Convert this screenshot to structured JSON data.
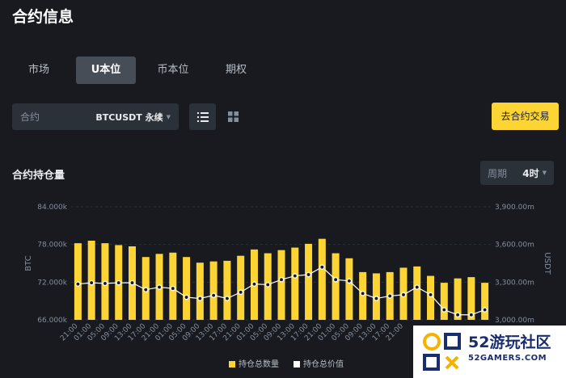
{
  "page": {
    "title": "合约信息"
  },
  "tabs": [
    {
      "label": "市场",
      "active": false
    },
    {
      "label": "U本位",
      "active": true
    },
    {
      "label": "币本位",
      "active": false
    },
    {
      "label": "期权",
      "active": false
    }
  ],
  "contract": {
    "label": "合约",
    "value": "BTCUSDT 永续"
  },
  "toolbar": {
    "list_view_icon": "list-icon",
    "grid_view_icon": "grid-icon",
    "trade_label": "去合约交易"
  },
  "section": {
    "title": "合约持仓量"
  },
  "period": {
    "label": "周期",
    "value": "4时"
  },
  "colors": {
    "accent": "#fcd535",
    "background": "#181a20",
    "panel": "#2b3139",
    "line": "#ffffff"
  },
  "chart_data": {
    "type": "bar",
    "x": [
      "21:00",
      "01:00",
      "05:00",
      "09:00",
      "13:00",
      "17:00",
      "21:00",
      "01:00",
      "05:00",
      "09:00",
      "13:00",
      "17:00",
      "21:00",
      "01:00",
      "05:00",
      "09:00",
      "13:00",
      "17:00",
      "21:00",
      "01:00",
      "05:00",
      "09:00",
      "13:00",
      "17:00",
      "21:00",
      "01:00",
      "05:00",
      "09:00",
      "13:00",
      "17:00",
      "21:00"
    ],
    "x_tick_labels": [
      "21:00",
      "01:00",
      "05:00",
      "09:00",
      "13:00",
      "17:00",
      "21:00",
      "01:00",
      "05:00",
      "09:00",
      "13:00",
      "17:00",
      "21:00",
      "01:00",
      "05:00",
      "09:00",
      "13:00",
      "17:00",
      "21:00",
      "01:00",
      "05:00",
      "09:00",
      "13:00",
      "17:00",
      "21:00"
    ],
    "y_left": {
      "label": "BTC",
      "ticks": [
        "84.000k",
        "78.000k",
        "72.000k",
        "66.000k"
      ],
      "range": [
        66000,
        84000
      ]
    },
    "y_right": {
      "label": "USDT",
      "ticks": [
        "3,900.00m",
        "3,600.00m",
        "3,300.00m",
        "3,000.00m"
      ],
      "range": [
        3000,
        3900
      ]
    },
    "series": [
      {
        "name": "持仓总数量",
        "type": "bar",
        "axis": "left",
        "color": "#fcd535",
        "values": [
          78200,
          78600,
          78200,
          77900,
          77700,
          76000,
          76500,
          76700,
          76000,
          75100,
          75300,
          75400,
          76200,
          77200,
          76600,
          77100,
          77500,
          78100,
          78900,
          76600,
          75800,
          73600,
          73400,
          73600,
          74300,
          74500,
          73000,
          71900,
          72600,
          72800,
          71900
        ]
      },
      {
        "name": "持仓总价值",
        "type": "line",
        "axis": "right",
        "color": "#ffffff",
        "values": [
          3285,
          3295,
          3290,
          3295,
          3295,
          3240,
          3260,
          3250,
          3180,
          3170,
          3195,
          3170,
          3220,
          3285,
          3280,
          3320,
          3350,
          3360,
          3420,
          3320,
          3310,
          3210,
          3170,
          3190,
          3200,
          3260,
          3200,
          3080,
          3040,
          3040,
          3080
        ]
      }
    ],
    "grid": true,
    "legend_placement": "bottom-center"
  },
  "watermark": {
    "title": "52游玩社区",
    "subtitle": "52GAMERS.COM"
  }
}
